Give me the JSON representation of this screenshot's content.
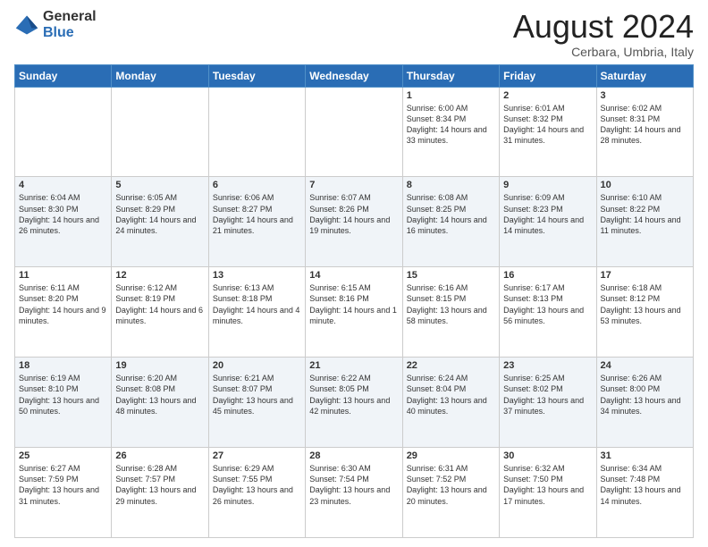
{
  "logo": {
    "general": "General",
    "blue": "Blue"
  },
  "header": {
    "title": "August 2024",
    "subtitle": "Cerbara, Umbria, Italy"
  },
  "weekdays": [
    "Sunday",
    "Monday",
    "Tuesday",
    "Wednesday",
    "Thursday",
    "Friday",
    "Saturday"
  ],
  "weeks": [
    [
      {
        "day": "",
        "info": ""
      },
      {
        "day": "",
        "info": ""
      },
      {
        "day": "",
        "info": ""
      },
      {
        "day": "",
        "info": ""
      },
      {
        "day": "1",
        "info": "Sunrise: 6:00 AM\nSunset: 8:34 PM\nDaylight: 14 hours and 33 minutes."
      },
      {
        "day": "2",
        "info": "Sunrise: 6:01 AM\nSunset: 8:32 PM\nDaylight: 14 hours and 31 minutes."
      },
      {
        "day": "3",
        "info": "Sunrise: 6:02 AM\nSunset: 8:31 PM\nDaylight: 14 hours and 28 minutes."
      }
    ],
    [
      {
        "day": "4",
        "info": "Sunrise: 6:04 AM\nSunset: 8:30 PM\nDaylight: 14 hours and 26 minutes."
      },
      {
        "day": "5",
        "info": "Sunrise: 6:05 AM\nSunset: 8:29 PM\nDaylight: 14 hours and 24 minutes."
      },
      {
        "day": "6",
        "info": "Sunrise: 6:06 AM\nSunset: 8:27 PM\nDaylight: 14 hours and 21 minutes."
      },
      {
        "day": "7",
        "info": "Sunrise: 6:07 AM\nSunset: 8:26 PM\nDaylight: 14 hours and 19 minutes."
      },
      {
        "day": "8",
        "info": "Sunrise: 6:08 AM\nSunset: 8:25 PM\nDaylight: 14 hours and 16 minutes."
      },
      {
        "day": "9",
        "info": "Sunrise: 6:09 AM\nSunset: 8:23 PM\nDaylight: 14 hours and 14 minutes."
      },
      {
        "day": "10",
        "info": "Sunrise: 6:10 AM\nSunset: 8:22 PM\nDaylight: 14 hours and 11 minutes."
      }
    ],
    [
      {
        "day": "11",
        "info": "Sunrise: 6:11 AM\nSunset: 8:20 PM\nDaylight: 14 hours and 9 minutes."
      },
      {
        "day": "12",
        "info": "Sunrise: 6:12 AM\nSunset: 8:19 PM\nDaylight: 14 hours and 6 minutes."
      },
      {
        "day": "13",
        "info": "Sunrise: 6:13 AM\nSunset: 8:18 PM\nDaylight: 14 hours and 4 minutes."
      },
      {
        "day": "14",
        "info": "Sunrise: 6:15 AM\nSunset: 8:16 PM\nDaylight: 14 hours and 1 minute."
      },
      {
        "day": "15",
        "info": "Sunrise: 6:16 AM\nSunset: 8:15 PM\nDaylight: 13 hours and 58 minutes."
      },
      {
        "day": "16",
        "info": "Sunrise: 6:17 AM\nSunset: 8:13 PM\nDaylight: 13 hours and 56 minutes."
      },
      {
        "day": "17",
        "info": "Sunrise: 6:18 AM\nSunset: 8:12 PM\nDaylight: 13 hours and 53 minutes."
      }
    ],
    [
      {
        "day": "18",
        "info": "Sunrise: 6:19 AM\nSunset: 8:10 PM\nDaylight: 13 hours and 50 minutes."
      },
      {
        "day": "19",
        "info": "Sunrise: 6:20 AM\nSunset: 8:08 PM\nDaylight: 13 hours and 48 minutes."
      },
      {
        "day": "20",
        "info": "Sunrise: 6:21 AM\nSunset: 8:07 PM\nDaylight: 13 hours and 45 minutes."
      },
      {
        "day": "21",
        "info": "Sunrise: 6:22 AM\nSunset: 8:05 PM\nDaylight: 13 hours and 42 minutes."
      },
      {
        "day": "22",
        "info": "Sunrise: 6:24 AM\nSunset: 8:04 PM\nDaylight: 13 hours and 40 minutes."
      },
      {
        "day": "23",
        "info": "Sunrise: 6:25 AM\nSunset: 8:02 PM\nDaylight: 13 hours and 37 minutes."
      },
      {
        "day": "24",
        "info": "Sunrise: 6:26 AM\nSunset: 8:00 PM\nDaylight: 13 hours and 34 minutes."
      }
    ],
    [
      {
        "day": "25",
        "info": "Sunrise: 6:27 AM\nSunset: 7:59 PM\nDaylight: 13 hours and 31 minutes."
      },
      {
        "day": "26",
        "info": "Sunrise: 6:28 AM\nSunset: 7:57 PM\nDaylight: 13 hours and 29 minutes."
      },
      {
        "day": "27",
        "info": "Sunrise: 6:29 AM\nSunset: 7:55 PM\nDaylight: 13 hours and 26 minutes."
      },
      {
        "day": "28",
        "info": "Sunrise: 6:30 AM\nSunset: 7:54 PM\nDaylight: 13 hours and 23 minutes."
      },
      {
        "day": "29",
        "info": "Sunrise: 6:31 AM\nSunset: 7:52 PM\nDaylight: 13 hours and 20 minutes."
      },
      {
        "day": "30",
        "info": "Sunrise: 6:32 AM\nSunset: 7:50 PM\nDaylight: 13 hours and 17 minutes."
      },
      {
        "day": "31",
        "info": "Sunrise: 6:34 AM\nSunset: 7:48 PM\nDaylight: 13 hours and 14 minutes."
      }
    ]
  ]
}
